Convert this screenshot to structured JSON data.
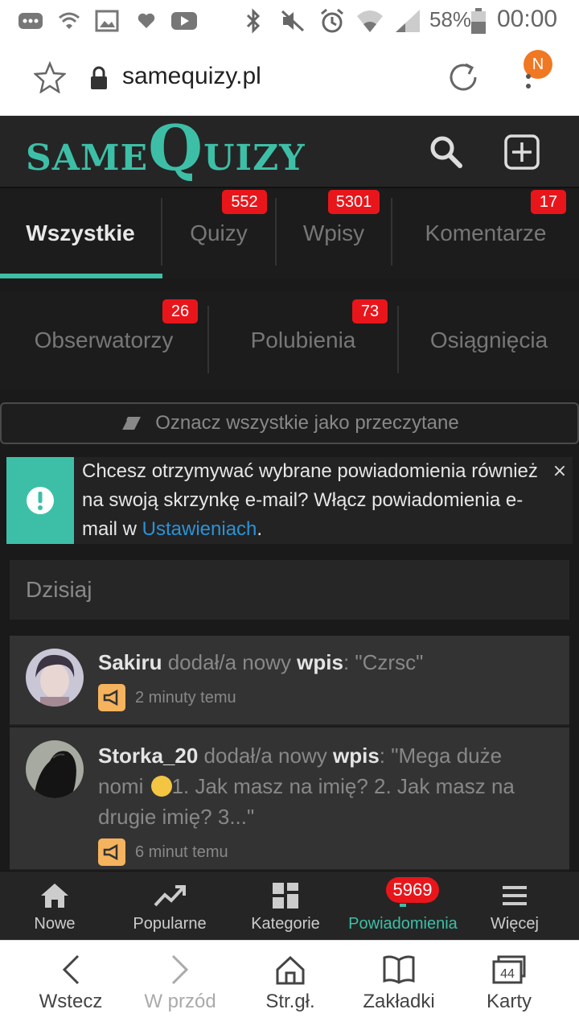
{
  "status_bar": {
    "battery": "58%",
    "time": "00:00",
    "icons": [
      "messages-icon",
      "wifi-calling-icon",
      "gallery-icon",
      "heart-icon",
      "youtube-icon",
      "bluetooth-icon",
      "mute-icon",
      "alarm-icon",
      "wifi-icon",
      "signal-icon",
      "battery-icon"
    ]
  },
  "browser": {
    "url": "samequizy.pl",
    "profile_badge": "N"
  },
  "site": {
    "logo_same": "SAME",
    "logo_q": "Q",
    "logo_uizy": "UIZY",
    "accent": "#3dbfa7",
    "badge_color": "#e8161b"
  },
  "tabs_row1": [
    {
      "label": "Wszystkie",
      "badge": ""
    },
    {
      "label": "Quizy",
      "badge": "552"
    },
    {
      "label": "Wpisy",
      "badge": "5301"
    },
    {
      "label": "Komentarze",
      "badge": "17"
    }
  ],
  "tabs_row2": [
    {
      "label": "Obserwatorzy",
      "badge": "26"
    },
    {
      "label": "Polubienia",
      "badge": "73"
    },
    {
      "label": "Osiągnięcia",
      "badge": ""
    }
  ],
  "mark_all": "Oznacz wszystkie jako przeczytane",
  "info": {
    "text_before": "Chcesz otrzymywać wybrane powiadomienia również na swoją skrzynkę e-mail? Włącz powiadomienia e-mail w ",
    "link": "Ustawieniach",
    "text_after": ".",
    "close": "×"
  },
  "date_header": "Dzisiaj",
  "notifications": [
    {
      "user": "Sakiru",
      "action": " dodał/a nowy ",
      "type": "wpis",
      "content_before": ": \"Czrsc\"",
      "content_after": "",
      "time": "2 minuty temu"
    },
    {
      "user": "Storka_20",
      "action": " dodał/a nowy ",
      "type": "wpis",
      "content_before": ": \"Mega duże nomi ",
      "content_after": "1. Jak masz na imię? 2. Jak masz na drugie imię? 3...\"",
      "time": "6 minut temu"
    }
  ],
  "site_nav": [
    {
      "label": "Nowe",
      "icon": "home-icon"
    },
    {
      "label": "Popularne",
      "icon": "trending-icon"
    },
    {
      "label": "Kategorie",
      "icon": "grid-icon"
    },
    {
      "label": "Powiadomienia",
      "icon": "bell-icon",
      "badge": "5969"
    },
    {
      "label": "Więcej",
      "icon": "menu-icon"
    }
  ],
  "browser_nav": [
    {
      "label": "Wstecz",
      "icon": "back-icon"
    },
    {
      "label": "W przód",
      "icon": "forward-icon"
    },
    {
      "label": "Str.gł.",
      "icon": "home-outline-icon"
    },
    {
      "label": "Zakładki",
      "icon": "book-icon"
    },
    {
      "label": "Karty",
      "icon": "tabs-icon",
      "count": "44"
    }
  ]
}
